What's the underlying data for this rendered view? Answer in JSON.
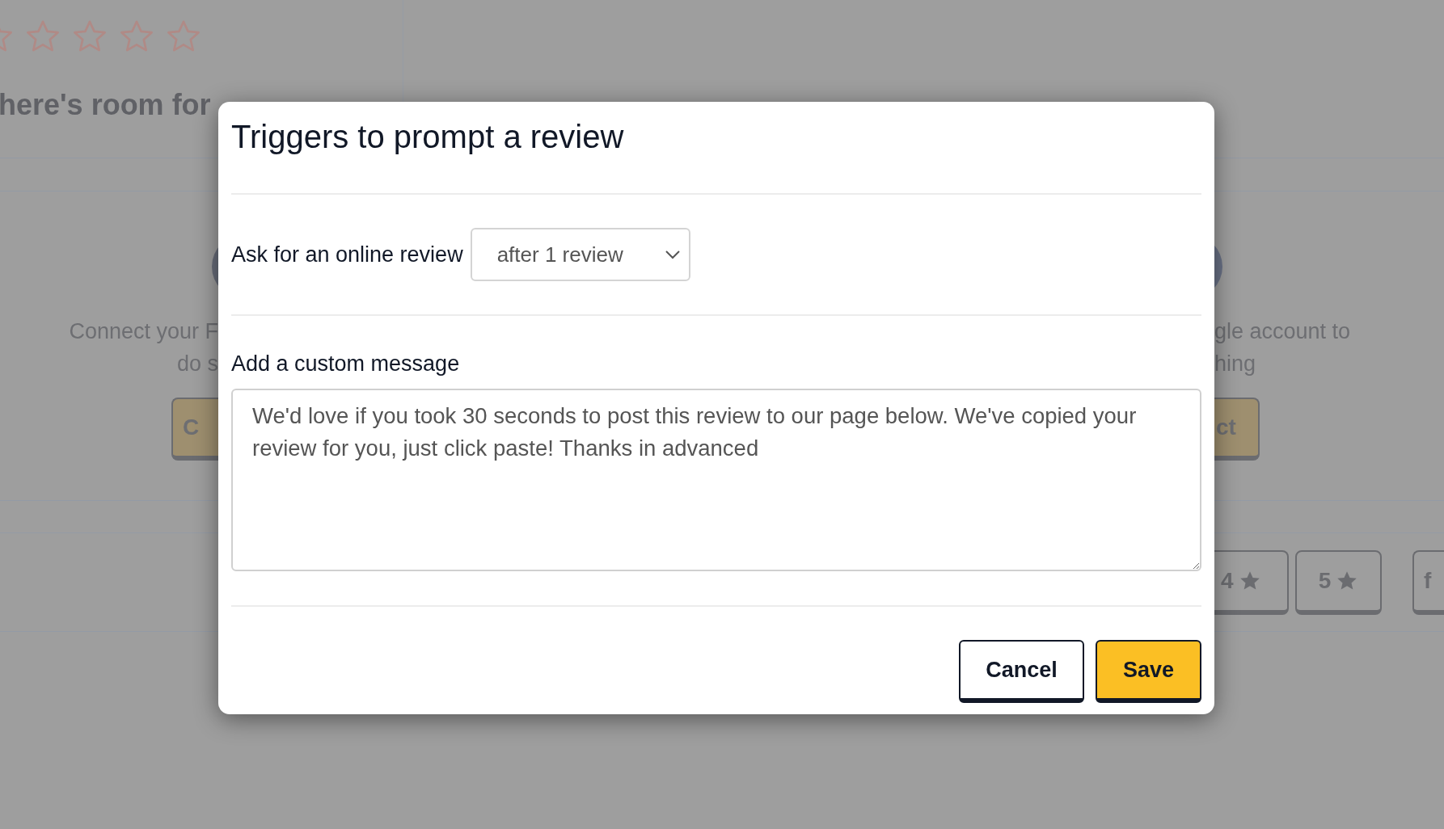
{
  "background": {
    "rating": {
      "stars": 0
    },
    "heading": "here's room for",
    "left_card": {
      "text_lines": [
        "Connect your F",
        "do s"
      ],
      "button": "C"
    },
    "right_card": {
      "text_lines": [
        "gle account to",
        "hing"
      ],
      "button": "ct"
    },
    "rating_buttons": [
      {
        "label": "4",
        "kind": "star"
      },
      {
        "label": "5",
        "kind": "star"
      },
      {
        "label": "f",
        "kind": "text"
      }
    ]
  },
  "dialog": {
    "title": "Triggers to prompt a review",
    "trigger": {
      "label": "Ask for an online review",
      "value": "after 1 review"
    },
    "message": {
      "label": "Add a custom message",
      "value": "We'd love if you took 30 seconds to post this review to our page below. We've copied your review for you, just click paste! Thanks in advanced"
    },
    "buttons": [
      {
        "label": "Cancel",
        "kind": "secondary"
      },
      {
        "label": "Save",
        "kind": "primary"
      }
    ]
  }
}
